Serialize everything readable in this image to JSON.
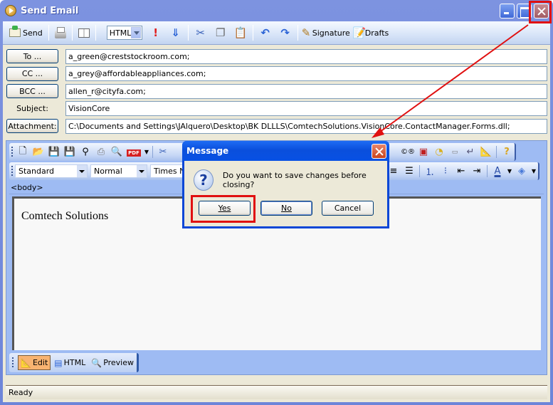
{
  "window": {
    "title": "Send Email",
    "controls": [
      "minimize",
      "maximize",
      "close"
    ]
  },
  "toolbar": {
    "send_label": "Send",
    "format_value": "HTML",
    "signature_label": "Signature",
    "drafts_label": "Drafts",
    "icons": [
      "send-icon",
      "print-icon",
      "address-book-icon",
      "high-priority-icon",
      "low-priority-icon",
      "cut-icon",
      "copy-icon",
      "paste-icon",
      "undo-icon",
      "redo-icon",
      "signature-icon",
      "drafts-icon"
    ]
  },
  "fields": {
    "to_label": "To ...",
    "to_value": "a_green@creststockroom.com;",
    "cc_label": "CC ...",
    "cc_value": "a_grey@affordableappliances.com;",
    "bcc_label": "BCC ...",
    "bcc_value": "allen_r@cityfa.com;",
    "subject_label": "Subject:",
    "subject_value": "VisionCore",
    "attachment_label": "Attachment:",
    "attachment_value": "C:\\Documents and Settings\\JAlquero\\Desktop\\BK DLLLS\\ComtechSolutions.VisionCore.ContactManager.Forms.dll;"
  },
  "editor": {
    "style_value": "Standard",
    "paragraph_value": "Normal",
    "font_value": "Times Ne",
    "tag_path": "<body>",
    "content": "Comtech Solutions",
    "modes": [
      "Edit",
      "HTML",
      "Preview"
    ],
    "active_mode": "Edit"
  },
  "dialog": {
    "title": "Message",
    "message": "Do you want to save changes before closing?",
    "yes_label": "Yes",
    "no_label": "No",
    "cancel_label": "Cancel"
  },
  "status": {
    "text": "Ready"
  },
  "annotations": {
    "highlight_color": "#e01010"
  }
}
